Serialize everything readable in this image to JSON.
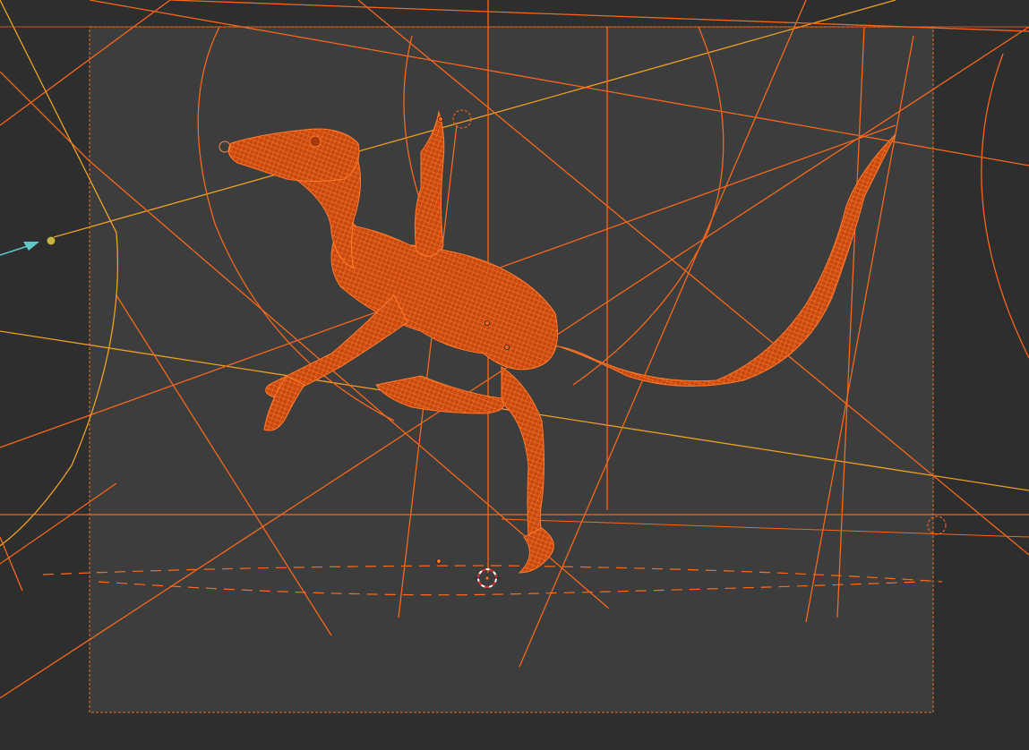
{
  "viewport": {
    "mode": "camera-view",
    "shading": "wireframe",
    "colors": {
      "background": "#2e2e2e",
      "camera_frame_fill": "#3d3d3d",
      "selection_orange": "#ff6a1a",
      "active_light": "#f5a623",
      "light_handle": "#c8b43c",
      "arrow_teal": "#5ec8c8",
      "frame_border": "#e0702a"
    },
    "objects": [
      {
        "name": "dinosaur-mesh",
        "icon": "mesh-wireframe",
        "selected": true
      },
      {
        "name": "armature-bones",
        "icon": "bone-icon",
        "selected": true
      },
      {
        "name": "scene-lines",
        "icon": "light-icon",
        "selected": true
      },
      {
        "name": "3d-cursor",
        "icon": "cursor-crosshair-icon"
      }
    ]
  }
}
